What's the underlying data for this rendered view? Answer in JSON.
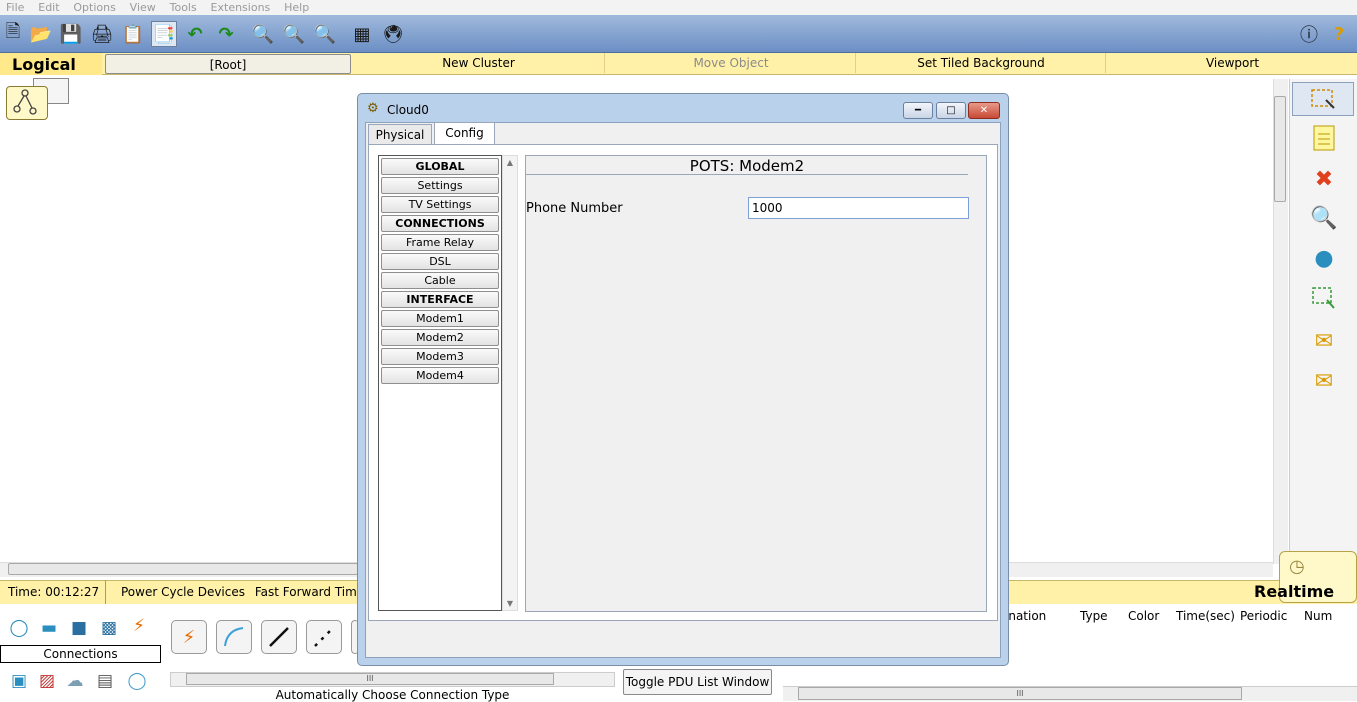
{
  "menu": [
    "File",
    "Edit",
    "Options",
    "View",
    "Tools",
    "Extensions",
    "Help"
  ],
  "toolbar": {
    "icons": [
      "new-icon",
      "open-icon",
      "save-icon",
      "print-icon",
      "activity-wizard-icon",
      "copy-icon",
      "undo-icon",
      "redo-icon",
      "zoom-in-icon",
      "zoom-reset-icon",
      "zoom-out-icon",
      "palette-icon",
      "custom-device-icon",
      "info-icon",
      "help-icon"
    ]
  },
  "workspace": {
    "mode": "Logical",
    "root": "[Root]",
    "new_cluster": "New Cluster",
    "move_object": "Move Object",
    "set_tiled_background": "Set Tiled Background",
    "viewport": "Viewport"
  },
  "dialog": {
    "title": "Cloud0",
    "tabs": [
      {
        "label": "Physical",
        "active": false
      },
      {
        "label": "Config",
        "active": true
      }
    ],
    "nav": [
      {
        "label": "GLOBAL",
        "header": true
      },
      {
        "label": "Settings",
        "header": false
      },
      {
        "label": "TV Settings",
        "header": false
      },
      {
        "label": "CONNECTIONS",
        "header": true
      },
      {
        "label": "Frame Relay",
        "header": false
      },
      {
        "label": "DSL",
        "header": false
      },
      {
        "label": "Cable",
        "header": false
      },
      {
        "label": "INTERFACE",
        "header": true
      },
      {
        "label": "Modem1",
        "header": false
      },
      {
        "label": "Modem2",
        "header": false
      },
      {
        "label": "Modem3",
        "header": false
      },
      {
        "label": "Modem4",
        "header": false
      }
    ],
    "panel": {
      "title": "POTS: Modem2",
      "phone_label": "Phone Number",
      "phone_value": "1000"
    }
  },
  "status": {
    "time": "Time: 00:12:27",
    "power_cycle": "Power Cycle Devices",
    "fast_forward": "Fast Forward Time",
    "mode": "Realtime"
  },
  "bottom": {
    "category_label": "Connections",
    "auto_connection": "Automatically Choose Connection Type",
    "toggle_pdu": "Toggle PDU List Window",
    "pdu_columns": [
      "ination",
      "Type",
      "Color",
      "Time(sec)",
      "Periodic",
      "Num"
    ],
    "scroll_grip": "III"
  },
  "colors": {
    "toolbar": "#7e9fcf",
    "workspace_bar": "#fff2a8",
    "dialog_frame": "#b9d1ea",
    "close_button": "#c74a35"
  }
}
